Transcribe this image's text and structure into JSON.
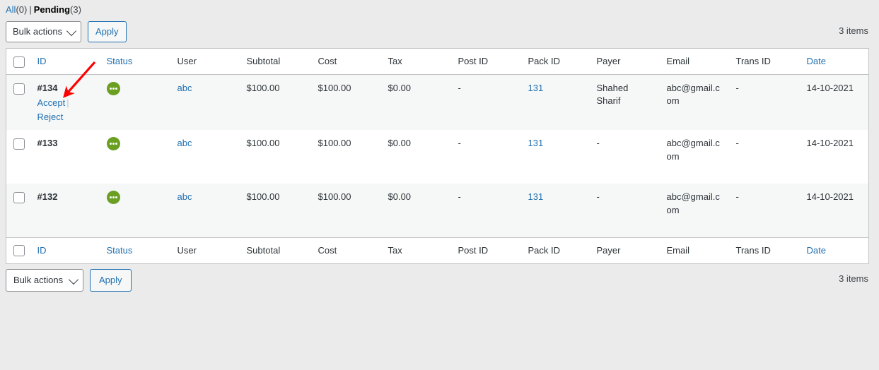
{
  "view_links": {
    "all_label": "All",
    "all_count": "(0)",
    "separator": "|",
    "pending_label": "Pending",
    "pending_count": "(3)"
  },
  "toolbar_top": {
    "bulk_actions_label": "Bulk actions",
    "apply_label": "Apply",
    "items_count": "3 items"
  },
  "toolbar_bottom": {
    "bulk_actions_label": "Bulk actions",
    "apply_label": "Apply",
    "items_count": "3 items"
  },
  "table": {
    "columns": [
      {
        "key": "cb",
        "label": "",
        "sortable": false
      },
      {
        "key": "id",
        "label": "ID",
        "sortable": true
      },
      {
        "key": "status",
        "label": "Status",
        "sortable": true
      },
      {
        "key": "user",
        "label": "User",
        "sortable": false
      },
      {
        "key": "subtotal",
        "label": "Subtotal",
        "sortable": false
      },
      {
        "key": "cost",
        "label": "Cost",
        "sortable": false
      },
      {
        "key": "tax",
        "label": "Tax",
        "sortable": false
      },
      {
        "key": "post_id",
        "label": "Post ID",
        "sortable": false
      },
      {
        "key": "pack_id",
        "label": "Pack ID",
        "sortable": false
      },
      {
        "key": "payer",
        "label": "Payer",
        "sortable": false
      },
      {
        "key": "email",
        "label": "Email",
        "sortable": false
      },
      {
        "key": "trans_id",
        "label": "Trans ID",
        "sortable": false
      },
      {
        "key": "date",
        "label": "Date",
        "sortable": true
      }
    ],
    "rows": [
      {
        "id": "#134",
        "actions": {
          "accept": "Accept",
          "divider": "|",
          "reject": "Reject"
        },
        "status_icon": "pending-ellipsis-icon",
        "user": "abc",
        "subtotal": "$100.00",
        "cost": "$100.00",
        "tax": "$0.00",
        "post_id": "-",
        "pack_id": "131",
        "payer": "Shahed Sharif",
        "email": "abc@gmail.com",
        "trans_id": "-",
        "date": "14-10-2021"
      },
      {
        "id": "#133",
        "actions": null,
        "status_icon": "pending-ellipsis-icon",
        "user": "abc",
        "subtotal": "$100.00",
        "cost": "$100.00",
        "tax": "$0.00",
        "post_id": "-",
        "pack_id": "131",
        "payer": "-",
        "email": "abc@gmail.com",
        "trans_id": "-",
        "date": "14-10-2021"
      },
      {
        "id": "#132",
        "actions": null,
        "status_icon": "pending-ellipsis-icon",
        "user": "abc",
        "subtotal": "$100.00",
        "cost": "$100.00",
        "tax": "$0.00",
        "post_id": "-",
        "pack_id": "131",
        "payer": "-",
        "email": "abc@gmail.com",
        "trans_id": "-",
        "date": "14-10-2021"
      }
    ]
  },
  "annotation": {
    "type": "arrow",
    "color": "#ff0000",
    "points_to": "accept-reject-row-actions"
  },
  "colors": {
    "link": "#2271b1",
    "status_green": "#6a9f22",
    "page_background": "#ebebeb",
    "row_alt_background": "#f6f7f7",
    "border": "#c3c4c7",
    "annotation_red": "#ff0000"
  }
}
